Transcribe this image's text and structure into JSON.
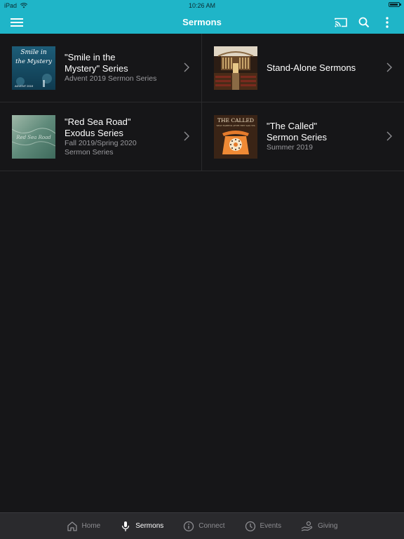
{
  "status_bar": {
    "device": "iPad",
    "time": "10:26 AM"
  },
  "header": {
    "title": "Sermons",
    "menu_icon": "hamburger-menu-icon",
    "cast_icon": "cast-icon",
    "search_icon": "search-icon",
    "more_icon": "more-vertical-icon",
    "color": "#1fb5c8"
  },
  "items": [
    {
      "title_lines": [
        "\"Smile in the",
        "Mystery\" Series"
      ],
      "subtitle_lines": [
        "Advent 2019 Sermon Series"
      ],
      "thumb_text_1": "Smile in",
      "thumb_text_2": "the Mystery",
      "thumb_caption": "ADVENT 2019"
    },
    {
      "title_lines": [
        "Stand-Alone Sermons"
      ],
      "subtitle_lines": []
    },
    {
      "title_lines": [
        "\"Red Sea Road\"",
        "Exodus Series"
      ],
      "subtitle_lines": [
        "Fall 2019/Spring 2020",
        "Sermon Series"
      ],
      "thumb_text_1": "Red Sea Road"
    },
    {
      "title_lines": [
        "\"The Called\"",
        "Sermon Series"
      ],
      "subtitle_lines": [
        "Summer 2019"
      ],
      "thumb_text_1": "THE CALLED",
      "thumb_text_2": "WHAT HAPPENS AFTER THEY SAID YES"
    }
  ],
  "tabs": [
    {
      "label": "Home",
      "icon": "home-icon",
      "active": false
    },
    {
      "label": "Sermons",
      "icon": "microphone-icon",
      "active": true
    },
    {
      "label": "Connect",
      "icon": "info-icon",
      "active": false
    },
    {
      "label": "Events",
      "icon": "clock-icon",
      "active": false
    },
    {
      "label": "Giving",
      "icon": "giving-hand-icon",
      "active": false
    }
  ]
}
